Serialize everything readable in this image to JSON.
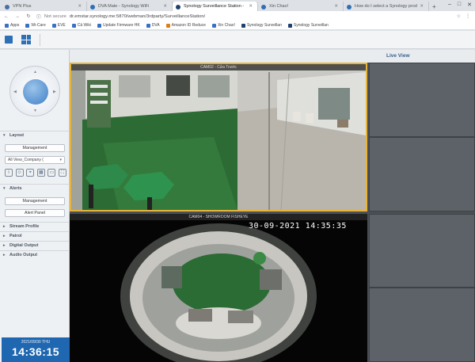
{
  "browser": {
    "tabs": [
      {
        "label": "VPN Plus",
        "favicon_color": "#4a6fa5",
        "active": false
      },
      {
        "label": "DVA Mate - Synology WiFi",
        "favicon_color": "#2f6fb6",
        "active": false
      },
      {
        "label": "Synology Surveillance Station - ",
        "favicon_color": "#2f6fb6",
        "active": true
      },
      {
        "label": "Xin Chao!",
        "favicon_color": "#2f6fb6",
        "active": false
      },
      {
        "label": "How do I select a Synology prod",
        "favicon_color": "#2f6fb6",
        "active": false
      }
    ],
    "address": {
      "security": "Not secure",
      "url": "dr.emstar.synology.me:5870/webman/3rdparty/SurveillanceStation/"
    },
    "bookmarks": [
      "Apps",
      "Wi-Care",
      "EVE",
      "Cả Wiki",
      "Update Firmware HK",
      "DVA",
      "Amazon ID Reduce",
      "Xin Chao!",
      "Synology Surveillan",
      "Synology Surveillan"
    ]
  },
  "toolbar": {
    "title": "Live View"
  },
  "left_panel": {
    "layout": {
      "header": "Layout",
      "management_button": "Management",
      "view_select": "All View_Company (",
      "tool_icons": [
        "info-icon",
        "person-icon",
        "location-icon",
        "map-icon",
        "layout-icon",
        "fullscreen-icon"
      ]
    },
    "alerts": {
      "header": "Alerts",
      "management_button": "Management",
      "alert_panel_button": "Alert Panel"
    },
    "sections": [
      "Stream Profile",
      "Patrol",
      "Digital Output",
      "Audio Output"
    ],
    "clock": {
      "date": "2021/09/30 THU",
      "time": "14:36:15"
    }
  },
  "cameras": [
    {
      "title": "CAM02 - Cửa Trước",
      "selected": true
    },
    {
      "title": "CAM04 - SHOWROOM FISHEYE",
      "selected": false,
      "osd": "30-09-2021 14:35:35"
    }
  ]
}
